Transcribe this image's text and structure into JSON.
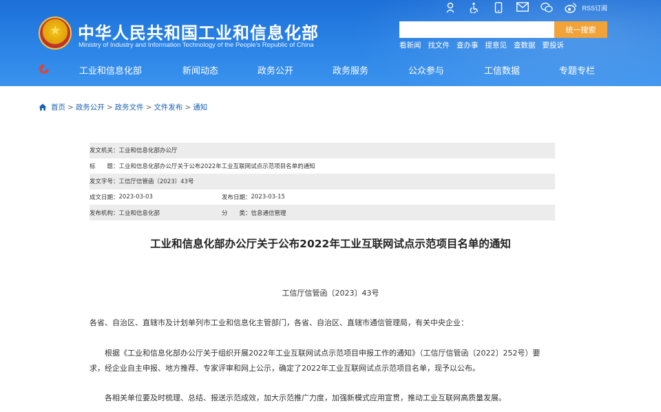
{
  "header": {
    "title_cn": "中华人民共和国工业和信息化部",
    "title_en": "Ministry of Industry and Information Technology of the People's Republic of China",
    "rss_label": "RSS订阅",
    "search": {
      "placeholder": "",
      "button_label": "统一搜索"
    },
    "quick_links": [
      "看新闻",
      "找文件",
      "查办事",
      "提意见",
      "查数据",
      "要投诉"
    ],
    "nav": [
      "工业和信息化部",
      "新闻动态",
      "政务公开",
      "政务服务",
      "公众参与",
      "工信数据",
      "专题专栏"
    ],
    "accent_color": "#2b84e6"
  },
  "breadcrumb": [
    "首页",
    "政务公开",
    "政务文件",
    "文件发布",
    "通知"
  ],
  "meta": {
    "issuer_label": "发文机关：",
    "issuer": "工业和信息化部办公厅",
    "subject_label": "标　　题：",
    "subject": "工业和信息化部办公厅关于公布2022年工业互联网试点示范项目名单的通知",
    "docno_label": "发文字号：",
    "docno": "工信厅信管函〔2023〕43号",
    "written_label": "成文日期：",
    "written": "2023-03-03",
    "published_label": "发布日期：",
    "published": "2023-03-15",
    "org_label": "发布机构：",
    "org": "工业和信息化部",
    "category_label": "分　　类：",
    "category": "信息通信管理"
  },
  "document": {
    "title": "工业和信息化部办公厅关于公布2022年工业互联网试点示范项目名单的通知",
    "number": "工信厅信管函〔2023〕43号",
    "salutation": "各省、自治区、直辖市及计划单列市工业和信息化主管部门，各省、自治区、直辖市通信管理局，有关中央企业：",
    "paragraph1": "　　根据《工业和信息化部办公厅关于组织开展2022年工业互联网试点示范项目申报工作的通知》（工信厅信管函〔2022〕252号）要求，经企业自主申报、地方推荐、专家评审和网上公示，确定了2022年工业互联网试点示范项目名单，现予以公布。",
    "paragraph2": "　　各相关单位要及时梳理、总结、报送示范成效，加大示范推广力度，加强新模式应用宣贯，推动工业互联网高质量发展。"
  }
}
